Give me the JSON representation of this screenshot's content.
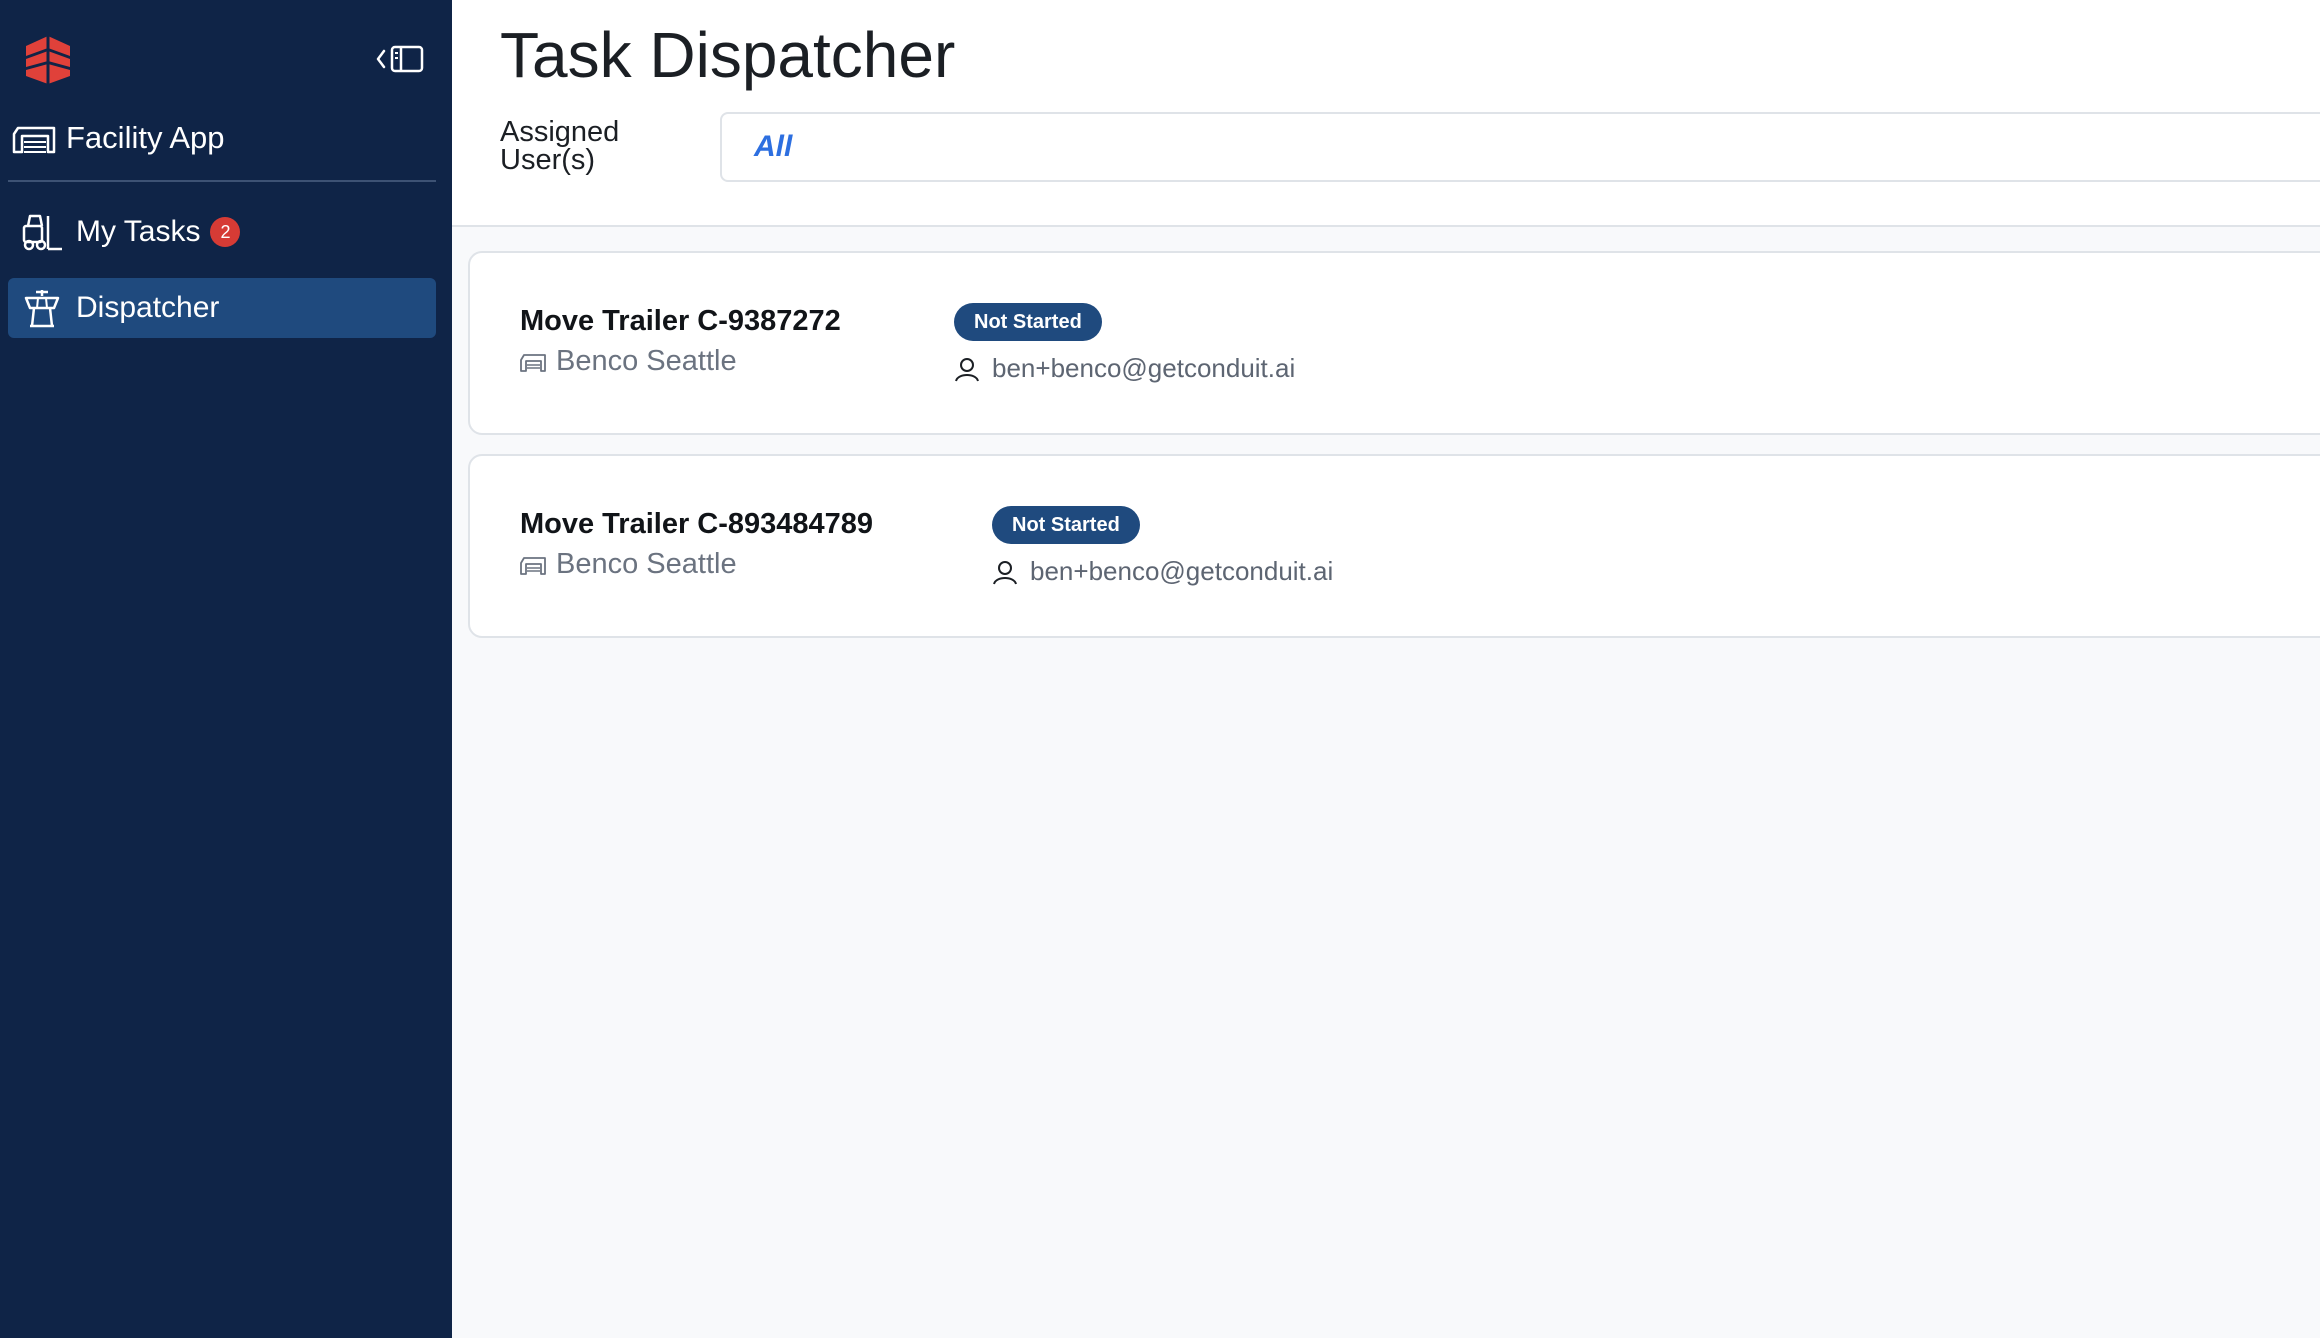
{
  "sidebar": {
    "app_label": "Facility App",
    "nav": [
      {
        "label": "My Tasks",
        "badge": "2",
        "icon": "forklift-icon"
      },
      {
        "label": "Dispatcher",
        "icon": "control-tower-icon",
        "active": true
      }
    ]
  },
  "header": {
    "title": "Task Dispatcher",
    "filter_label": "Assigned User(s)",
    "filter_value": "All"
  },
  "tasks": [
    {
      "title": "Move Trailer C-9387272",
      "site": "Benco Seattle",
      "status": "Not Started",
      "assignee": "ben+benco@getconduit.ai"
    },
    {
      "title": "Move Trailer C-893484789",
      "site": "Benco Seattle",
      "status": "Not Started",
      "assignee": "ben+benco@getconduit.ai"
    }
  ],
  "colors": {
    "sidebar_bg": "#0f2447",
    "active_nav_bg": "#1f4a7e",
    "badge": "#d63b35",
    "status_bg": "#1f4a7e",
    "filter_accent": "#2d6fe0",
    "brand": "#e0413a"
  }
}
